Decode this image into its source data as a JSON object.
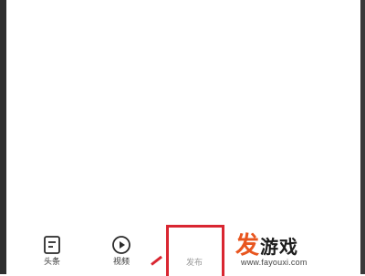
{
  "tabbar": {
    "items": [
      {
        "label": "头条",
        "icon": "news-icon"
      },
      {
        "label": "视频",
        "icon": "play-circle-icon"
      },
      {
        "label": "发布",
        "icon": "publish-icon"
      }
    ]
  },
  "watermark": {
    "logo_char": "发",
    "logo_rest": "游戏",
    "url": "www.fayouxi.com"
  },
  "colors": {
    "highlight": "#d92631",
    "watermark_accent": "#e8551e"
  }
}
